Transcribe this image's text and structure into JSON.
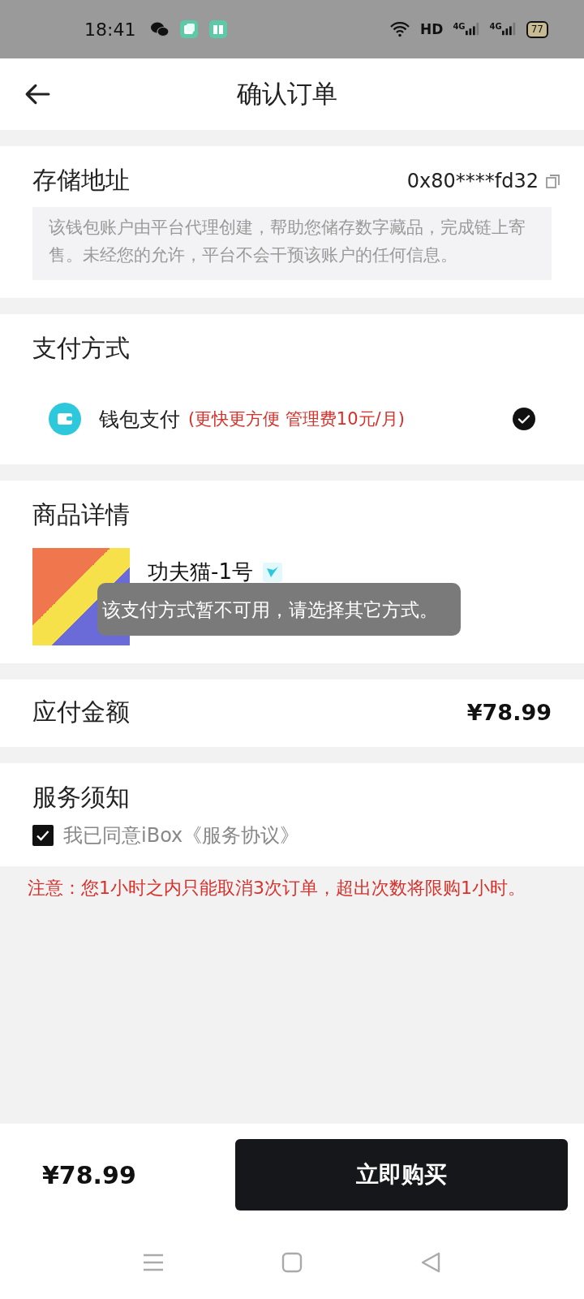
{
  "status_bar": {
    "time": "18:41",
    "network": "HD",
    "signals": [
      "4G",
      "4G"
    ],
    "battery": "77"
  },
  "header": {
    "title": "确认订单"
  },
  "storage": {
    "title": "存储地址",
    "address": "0x80****fd32",
    "note": "该钱包账户由平台代理创建，帮助您储存数字藏品，完成链上寄售。未经您的允许，平台不会干预该账户的任何信息。"
  },
  "payment": {
    "title": "支付方式",
    "methods": [
      {
        "name": "钱包支付",
        "note": "(更快更方便 管理费10元/月)",
        "selected": true
      }
    ]
  },
  "product": {
    "title": "商品详情",
    "name": "功夫猫-1号"
  },
  "toast": {
    "message": "该支付方式暂不可用，请选择其它方式。"
  },
  "amount": {
    "label": "应付金额",
    "value": "¥78.99"
  },
  "service": {
    "title": "服务须知",
    "agreement": {
      "text": "我已同意iBox《服务协议》",
      "checked": true
    }
  },
  "notice": "注意：您1小时之内只能取消3次订单，超出次数将限购1小时。",
  "footer": {
    "price": "¥78.99",
    "button": "立即购买"
  }
}
